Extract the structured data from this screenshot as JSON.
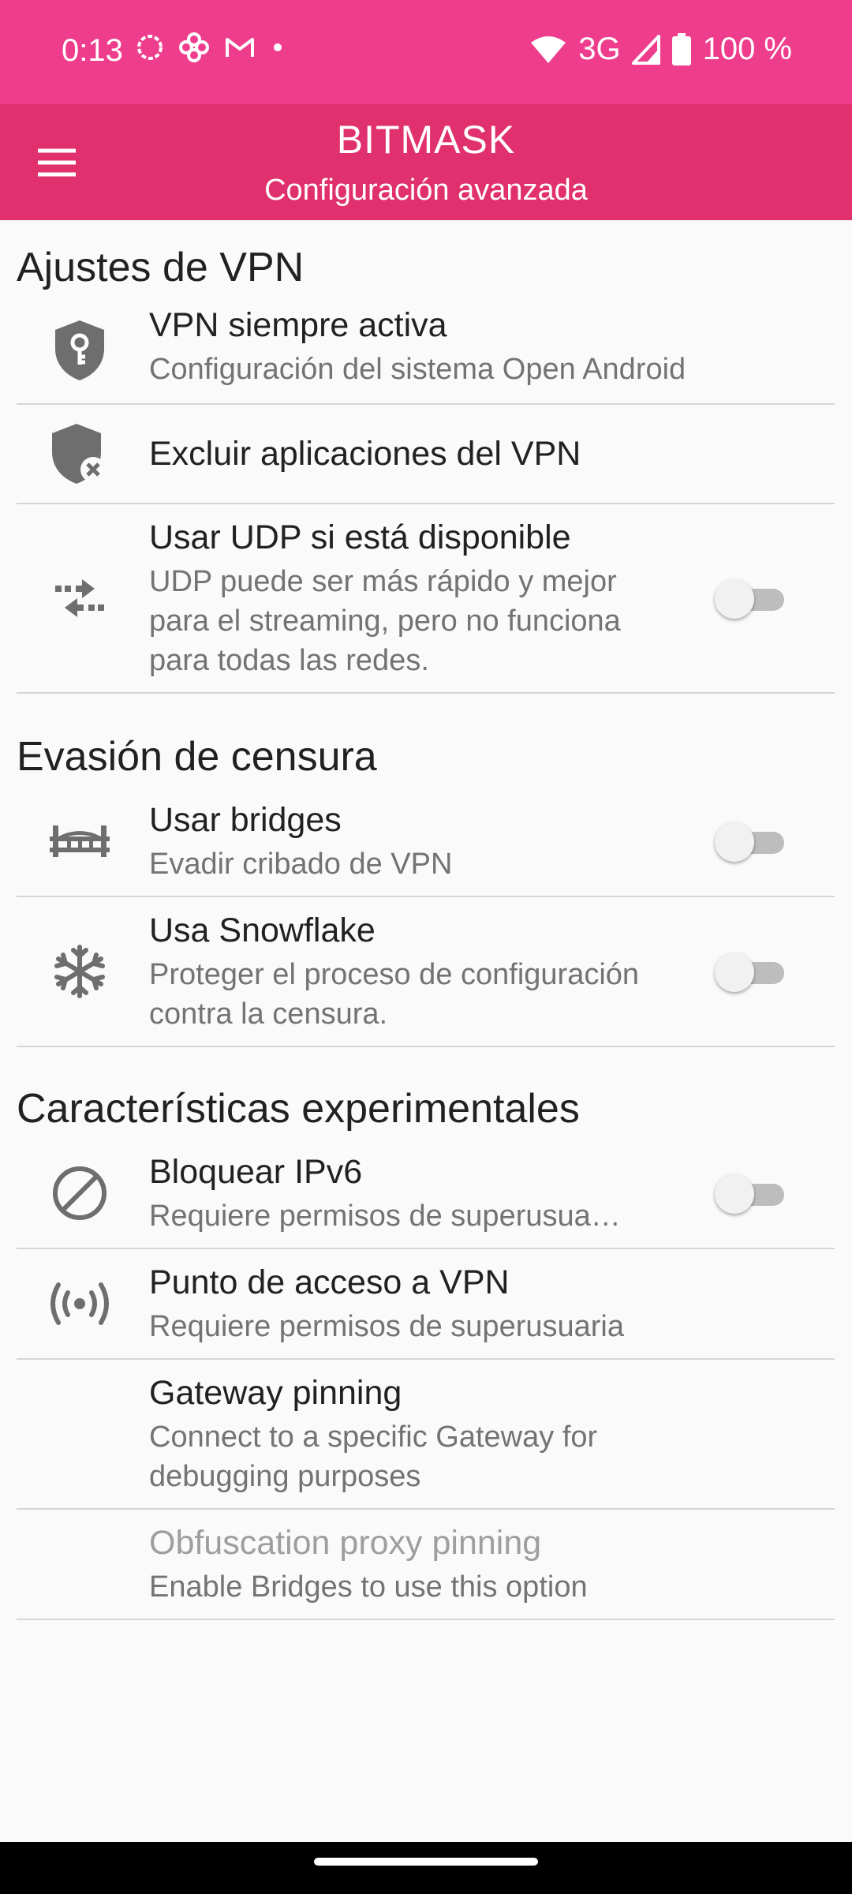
{
  "status": {
    "time": "0:13",
    "network": "3G",
    "battery": "100 %",
    "colors": {
      "statusbar": "#ee3d8c",
      "appbar": "#e0306e"
    }
  },
  "app": {
    "title": "BITMASK",
    "subtitle": "Configuración avanzada"
  },
  "sections": [
    {
      "title": "Ajustes de VPN",
      "items": [
        {
          "title": "VPN siempre activa",
          "subtitle": "Configuración del sistema Open Android",
          "icon": "shield-key-icon"
        },
        {
          "title": "Excluir aplicaciones del VPN",
          "icon": "shield-x-icon"
        },
        {
          "title": "Usar UDP si está disponible",
          "subtitle": "UDP puede ser más rápido y mejor para el streaming, pero no funciona para todas las redes.",
          "icon": "swap-arrows-icon",
          "toggle": false
        }
      ]
    },
    {
      "title": "Evasión de censura",
      "items": [
        {
          "title": "Usar bridges",
          "subtitle": "Evadir cribado de VPN",
          "icon": "bridge-icon",
          "toggle": false
        },
        {
          "title": "Usa Snowflake",
          "subtitle": "Proteger el proceso de configuración contra la censura.",
          "icon": "snowflake-icon",
          "toggle": false
        }
      ]
    },
    {
      "title": "Características experimentales",
      "items": [
        {
          "title": "Bloquear IPv6",
          "subtitle": "Requiere permisos de superusua…",
          "icon": "block-icon",
          "toggle": false
        },
        {
          "title": "Punto de acceso a VPN",
          "subtitle": "Requiere permisos de superusuaria",
          "icon": "hotspot-icon"
        },
        {
          "title": "Gateway pinning",
          "subtitle": "Connect to a specific Gateway for debugging purposes"
        },
        {
          "title": "Obfuscation proxy pinning",
          "subtitle": "Enable Bridges to use this option",
          "disabled": true
        }
      ]
    }
  ]
}
